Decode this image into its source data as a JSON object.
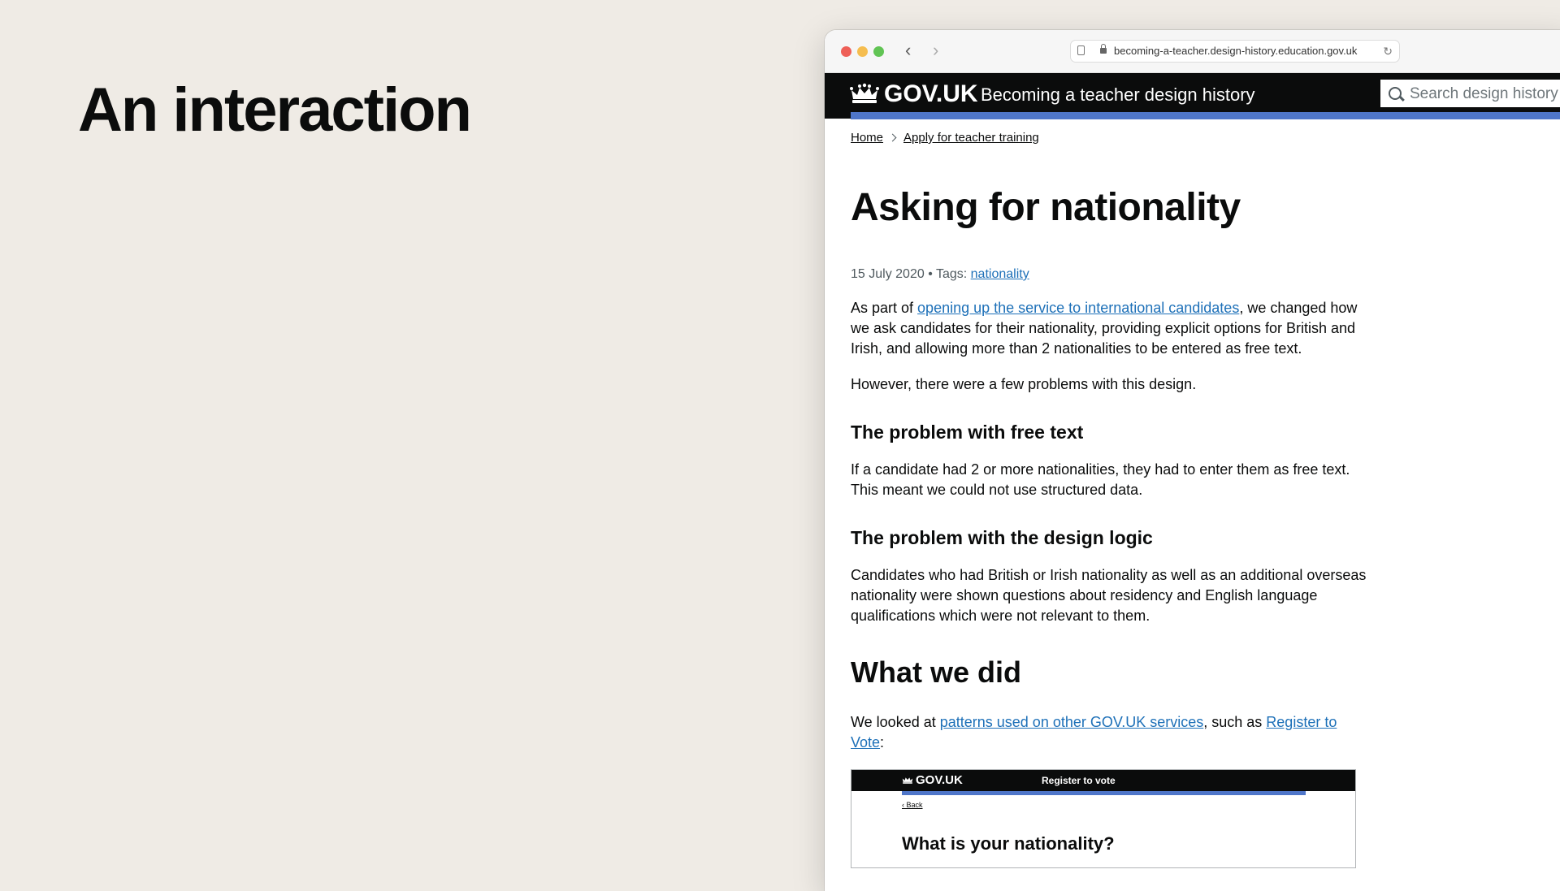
{
  "slide": {
    "title": "An interaction"
  },
  "browser": {
    "url": "becoming-a-teacher.design-history.education.gov.uk",
    "back_glyph": "‹",
    "forward_glyph": "›",
    "reload_glyph": "↻"
  },
  "header": {
    "logo": "GOV.UK",
    "service_name": "Becoming a teacher design history",
    "search_placeholder": "Search design history"
  },
  "breadcrumbs": [
    {
      "label": "Home"
    },
    {
      "label": "Apply for teacher training"
    }
  ],
  "article": {
    "title": "Asking for nationality",
    "date": "15 July 2020",
    "tags_label": "• Tags:",
    "tag": "nationality",
    "p1_before": "As part of ",
    "p1_link": "opening up the service to international candidates",
    "p1_after": ", we changed how we ask candidates for their nationality, providing explicit options for British and Irish, and allowing more than 2 nationalities to be entered as free text.",
    "p2": "However, there were a few problems with this design.",
    "h_free_text": "The problem with free text",
    "p3": "If a candidate had 2 or more nationalities, they had to enter them as free text. This meant we could not use structured data.",
    "h_design_logic": "The problem with the design logic",
    "p4": "Candidates who had British or Irish nationality as well as an additional overseas nationality were shown questions about residency and English language qualifications which were not relevant to them.",
    "h_what_we_did": "What we did",
    "p5_before": "We looked at ",
    "p5_link1": "patterns used on other GOV.UK services",
    "p5_mid": ", such as ",
    "p5_link2": "Register to Vote",
    "p5_after": ":"
  },
  "embed": {
    "logo": "GOV.UK",
    "service": "Register to vote",
    "back": "‹ Back",
    "question": "What is your nationality?"
  },
  "colors": {
    "background": "#efebe5",
    "header": "#0b0c0c",
    "accent_bar": "#4f76c9",
    "link": "#1d70b8"
  }
}
